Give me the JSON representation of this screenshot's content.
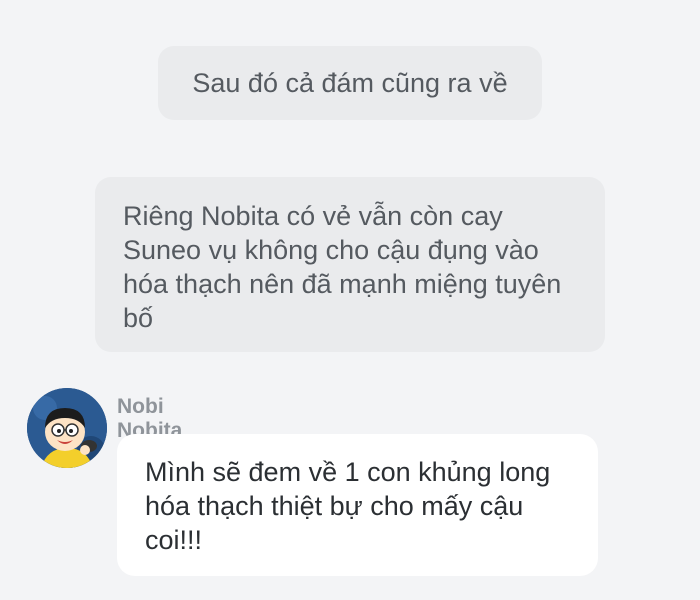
{
  "narration": [
    {
      "text": "Sau đó cả đám cũng ra về"
    },
    {
      "text": "Riêng Nobita có vẻ vẫn còn cay Suneo vụ không cho cậu đụng vào hóa thạch nên đã mạnh miệng tuyên bố"
    }
  ],
  "message": {
    "sender": "Nobi Nobita",
    "avatar_icon": "nobita-avatar-icon",
    "text": "Mình sẽ đem về 1 con khủng long hóa thạch thiệt bự cho mấy cậu coi!!!"
  },
  "colors": {
    "background": "#f3f4f6",
    "narration_bubble": "#eaebed",
    "message_bubble": "#ffffff",
    "sender_name": "#8f949a"
  }
}
